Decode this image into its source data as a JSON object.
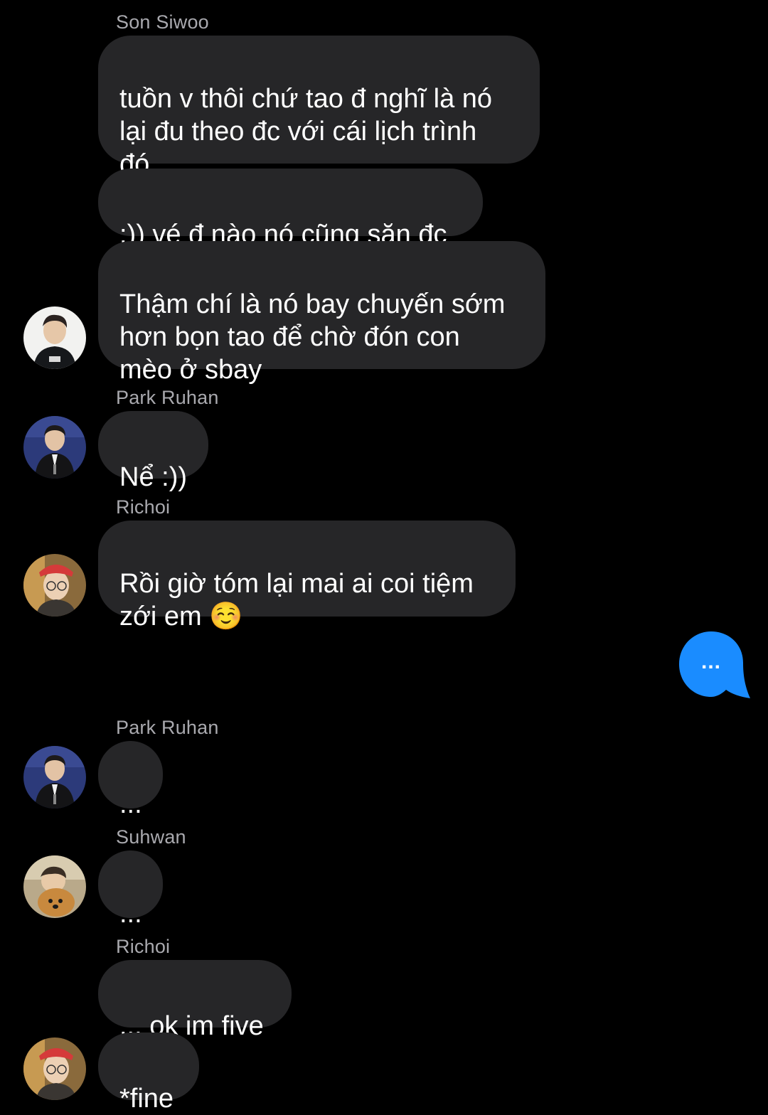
{
  "colors": {
    "background": "#000000",
    "incoming_bubble": "#262628",
    "outgoing_bubble": "#1a8cff",
    "sender_name": "#a9a9ae",
    "text": "#ffffff"
  },
  "messages": [
    {
      "sender": "Son Siwoo",
      "text": "tuồn v thôi chứ tao đ nghĩ là nó\nlại đu theo đc với cái lịch trình\nđó"
    },
    {
      "text": ":)) vé đ nào nó cũng săn đc"
    },
    {
      "text": "Thậm chí là nó bay chuyến sớm\nhơn bọn tao để chờ đón con\nmèo ở sbay",
      "avatar": "son-siwoo-avatar"
    },
    {
      "sender": "Park Ruhan",
      "text": "Nể :))",
      "avatar": "park-ruhan-avatar"
    },
    {
      "sender": "Richoi",
      "text": "Rồi giờ tóm lại mai ai coi tiệm\nzới em ☺️",
      "avatar": "richoi-avatar"
    },
    {
      "outgoing": true,
      "text": "..."
    },
    {
      "sender": "Park Ruhan",
      "text": "...",
      "avatar": "park-ruhan-avatar"
    },
    {
      "sender": "Suhwan",
      "text": "...",
      "avatar": "suhwan-avatar"
    },
    {
      "sender": "Richoi",
      "text": "... ok im five"
    },
    {
      "text": "*fine",
      "avatar": "richoi-avatar"
    }
  ]
}
